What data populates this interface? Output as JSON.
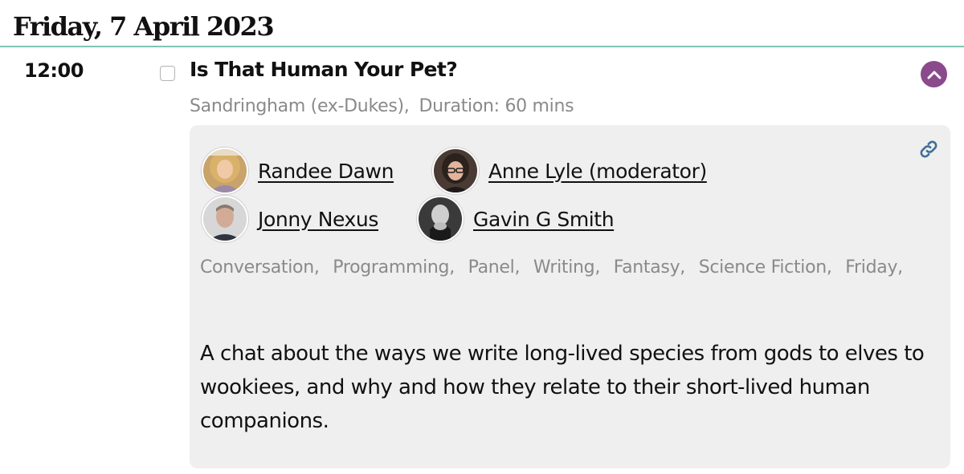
{
  "day_header": "Friday, 7 April 2023",
  "session": {
    "time": "12:00",
    "title": "Is That Human Your Pet?",
    "room": "Sandringham (ex-Dukes),",
    "duration": "Duration: 60 mins",
    "participants": [
      {
        "name": "Randee Dawn",
        "avatar": "avatar-randee"
      },
      {
        "name": "Anne Lyle (moderator)",
        "avatar": "avatar-anne"
      },
      {
        "name": "Jonny Nexus",
        "avatar": "avatar-jonny"
      },
      {
        "name": "Gavin G Smith",
        "avatar": "avatar-gavin"
      }
    ],
    "tags": [
      "Conversation,",
      "Programming,",
      "Panel,",
      "Writing,",
      "Fantasy,",
      "Science Fiction,",
      "Friday,"
    ],
    "description": "A chat about the ways we write long-lived species from gods to elves to wookiees, and why and how they relate to their short-lived human companions."
  },
  "icons": {
    "collapse": "chevron-up-icon",
    "link": "link-icon"
  },
  "colors": {
    "accent": "#8a4a8c",
    "rule": "#7fc4b7",
    "link_icon": "#3f6f9a",
    "panel_bg": "#efefef",
    "muted_text": "#8a8a8a"
  }
}
